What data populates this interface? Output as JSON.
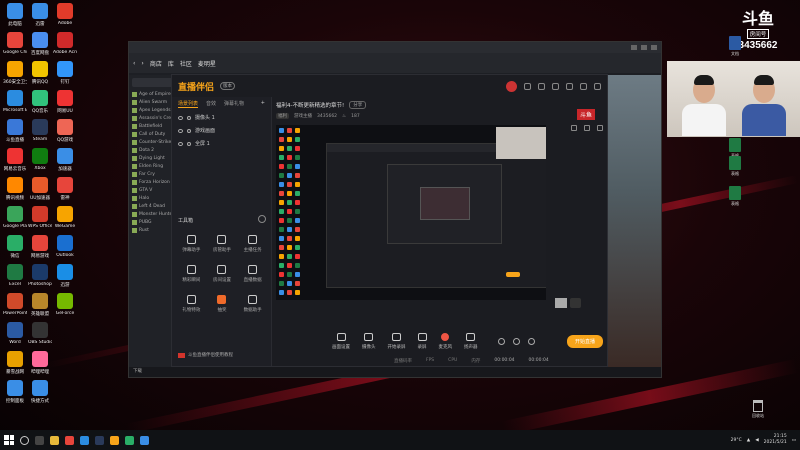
{
  "desktop": {
    "icons_col1": [
      {
        "label": "此电脑",
        "color": "#3a8ee6"
      },
      {
        "label": "Google Chrome",
        "color": "#e7453b"
      },
      {
        "label": "360安全卫士",
        "color": "#f7a400"
      },
      {
        "label": "Microsoft Edge",
        "color": "#2b8ce0"
      },
      {
        "label": "斗鱼直播",
        "color": "#3a78d8"
      },
      {
        "label": "网易云音乐",
        "color": "#e33"
      },
      {
        "label": "腾讯视频",
        "color": "#ff8800"
      },
      {
        "label": "Google Play",
        "color": "#3aa55a"
      },
      {
        "label": "微信",
        "color": "#2aae67"
      },
      {
        "label": "Excel",
        "color": "#1f7a43"
      },
      {
        "label": "PowerPoint",
        "color": "#d04a2a"
      },
      {
        "label": "Word",
        "color": "#2b5aa3"
      },
      {
        "label": "暴雪战网",
        "color": "#e8a000"
      },
      {
        "label": "控制面板",
        "color": "#3a8ee6"
      }
    ],
    "icons_col2": [
      {
        "label": "迅雷",
        "color": "#3a8ee6"
      },
      {
        "label": "百度网盘",
        "color": "#4a8ef0"
      },
      {
        "label": "腾讯QQ",
        "color": "#f2c400"
      },
      {
        "label": "QQ音乐",
        "color": "#31c27c"
      },
      {
        "label": "Steam",
        "color": "#2a3a5a"
      },
      {
        "label": "Xbox",
        "color": "#107c10"
      },
      {
        "label": "UU加速器",
        "color": "#e85a2a"
      },
      {
        "label": "WPS Office",
        "color": "#d23a2a"
      },
      {
        "label": "网易游戏",
        "color": "#e7453b"
      },
      {
        "label": "Photoshop",
        "color": "#1b3a6a"
      },
      {
        "label": "英雄联盟",
        "color": "#b8862a"
      },
      {
        "label": "OBS Studio",
        "color": "#333"
      },
      {
        "label": "哔哩哔哩",
        "color": "#ff6a9a"
      },
      {
        "label": "快捷方式",
        "color": "#3a8ee6"
      }
    ],
    "icons_col3": [
      {
        "label": "Adobe",
        "color": "#e13b2a"
      },
      {
        "label": "Adobe Acrobat",
        "color": "#d02a2a"
      },
      {
        "label": "钉钉",
        "color": "#3296fa"
      },
      {
        "label": "网易UU",
        "color": "#e33"
      },
      {
        "label": "QQ游戏",
        "color": "#e65"
      },
      {
        "label": "加速器",
        "color": "#3a8ee6"
      },
      {
        "label": "雷神",
        "color": "#e7453b"
      },
      {
        "label": "WeGame",
        "color": "#f7a400"
      },
      {
        "label": "Outlook",
        "color": "#1a6fd0"
      },
      {
        "label": "迅游",
        "color": "#1a8ee6"
      },
      {
        "label": "GeForce",
        "color": "#76b900"
      }
    ],
    "right_files": [
      {
        "label": "文档",
        "color": "#2b5aa3"
      },
      {
        "label": "表格",
        "color": "#1f7a43"
      },
      {
        "label": "表格",
        "color": "#1f7a43"
      },
      {
        "label": "表格",
        "color": "#1f7a43"
      }
    ],
    "recycle_label": "回收站"
  },
  "app_window": {
    "nav": [
      "商店",
      "库",
      "社区",
      "麦明星"
    ],
    "left_list": [
      "Age of Empires",
      "Alien Swarm",
      "Apex Legends",
      "Assassin's Creed",
      "Battlefield",
      "Call of Duty",
      "Counter-Strike",
      "Dota 2",
      "Dying Light",
      "Elden Ring",
      "Far Cry",
      "Forza Horizon",
      "GTA V",
      "Halo",
      "Left 4 Dead",
      "Monster Hunter",
      "PUBG",
      "Rust"
    ],
    "status": "下载"
  },
  "studio": {
    "brand": "直播伴侣",
    "badge": "版本",
    "tabs": [
      "场景列表",
      "音效",
      "弹幕礼物"
    ],
    "scenes": [
      "摄像头 1",
      "游戏画面",
      "全屏 1"
    ],
    "toolbox_title": "工具箱",
    "tools": [
      "弹幕助手",
      "房管助手",
      "主播任务",
      "精彩瞬间",
      "房间设置",
      "直播数据",
      "礼物特效",
      "抽奖",
      "数据助手"
    ],
    "tip": "斗鱼直播伴侣使用教程",
    "room_title": "福利4-不断更新精选的章节!",
    "share_label": "分享",
    "room_tag": "福利",
    "room_owner": "游戏主播",
    "room_id": "3435662",
    "follow_count": "187",
    "douyu_tag": "斗鱼",
    "bottom_items": [
      "画面设置",
      "摄像头",
      "开始录屏",
      "录屏",
      "麦克风",
      "扬声器"
    ],
    "go_live": "开始直播",
    "stats": [
      "直播码率",
      "FPS",
      "CPU",
      "内存"
    ],
    "timer": "00:00:04",
    "timer2": "00:00:04"
  },
  "room_logo": {
    "mark": "斗鱼",
    "sub": "房间号",
    "number": "3435662"
  },
  "taskbar": {
    "temp": "29°C",
    "time": "21:15",
    "date": "2021/5/21"
  }
}
